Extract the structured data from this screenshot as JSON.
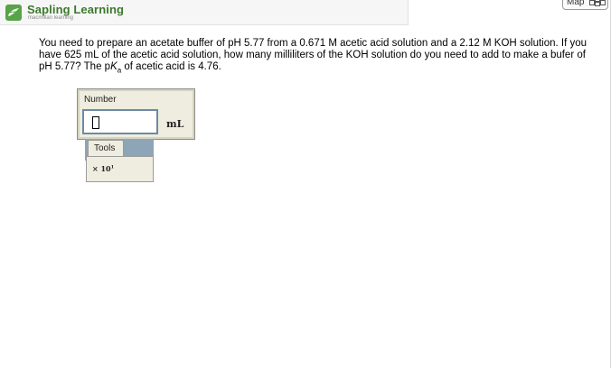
{
  "header": {
    "brand_name": "Sapling Learning",
    "brand_sub": "macmillan learning",
    "brand_color": "#3b7a2c",
    "logo_icon": "sapling-leaf-icon"
  },
  "map_button": {
    "label": "Map",
    "icon": "map-blocks-icon"
  },
  "question": {
    "part1": "You need to prepare an acetate buffer of pH 5.77 from a 0.671 M acetic acid solution and a 2.12 M KOH solution. If you have 625 mL of the acetic acid solution, how many milliliters of the KOH solution do you need to add to make a bufer of pH 5.77? The p",
    "k": "K",
    "a": "a",
    "part2": " of acetic acid is 4.76."
  },
  "answer": {
    "number_label": "Number",
    "input_value": "",
    "unit": "mL"
  },
  "tools": {
    "label": "Tools",
    "sci_prefix": "× 10",
    "sci_exp": "1"
  }
}
